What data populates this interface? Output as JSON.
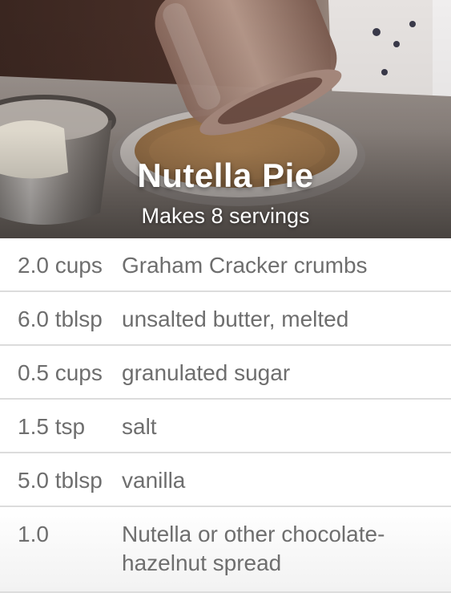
{
  "recipe": {
    "title": "Nutella Pie",
    "subtitle": "Makes 8 servings"
  },
  "ingredients": [
    {
      "quantity": "2.0 cups",
      "name": "Graham Cracker crumbs"
    },
    {
      "quantity": "6.0 tblsp",
      "name": "unsalted butter, melted"
    },
    {
      "quantity": "0.5 cups",
      "name": "granulated sugar"
    },
    {
      "quantity": "1.5 tsp",
      "name": "salt"
    },
    {
      "quantity": "5.0 tblsp",
      "name": "vanilla"
    },
    {
      "quantity": "1.0",
      "name": "Nutella or other chocolate-hazelnut spread"
    }
  ],
  "colors": {
    "text": "#6e6e6e",
    "divider": "#dcdcdc",
    "title": "#ffffff"
  }
}
